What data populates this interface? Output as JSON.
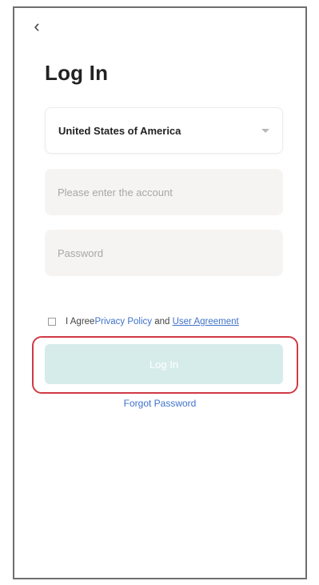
{
  "header": {
    "back_icon": "chevron-left-icon",
    "back_glyph": "‹"
  },
  "login": {
    "title": "Log In",
    "country": {
      "selected": "United States of America",
      "icon": "caret-down-icon"
    },
    "account_placeholder": "Please enter the account",
    "password_placeholder": "Password",
    "agreement": {
      "prefix": "I Agree",
      "privacy_link": "Privacy Policy",
      "and_text": " and ",
      "user_link": "User Agreement"
    },
    "button_label": "Log In",
    "forgot_link": "Forgot Password"
  },
  "colors": {
    "accent": "#3f72c9",
    "button_bg": "#d6eceb",
    "highlight": "#cf3a45"
  }
}
